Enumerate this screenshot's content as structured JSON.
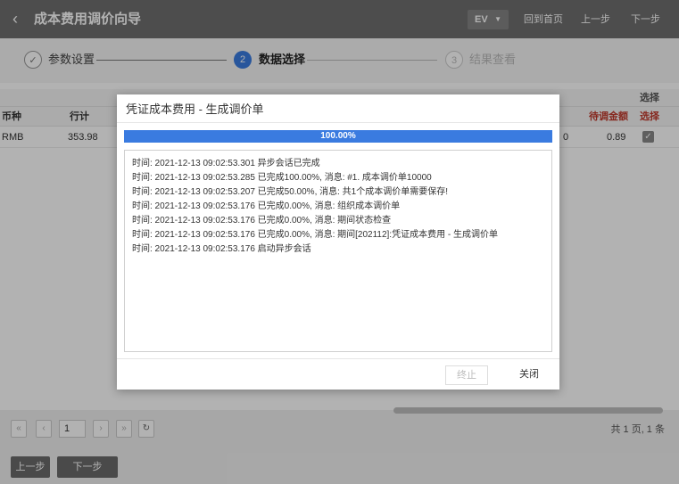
{
  "header": {
    "title": "成本费用调价向导",
    "org_select": "EV",
    "links": [
      "回到首页",
      "上一步",
      "下一步"
    ]
  },
  "steps": [
    {
      "num": "✓",
      "label": "参数设置",
      "state": "done"
    },
    {
      "num": "2",
      "label": "数据选择",
      "state": "active"
    },
    {
      "num": "3",
      "label": "结果查看",
      "state": "pending"
    }
  ],
  "grid": {
    "group_header": "选择",
    "columns": [
      "币种",
      "行计",
      "待调金额",
      "选择"
    ],
    "row": {
      "currency": "RMB",
      "amount": "353.98",
      "hidden_tail": "0",
      "pending": "0.89",
      "selected": true
    }
  },
  "pager": {
    "page": "1",
    "total": "共 1 页, 1 条"
  },
  "footer_buttons": [
    "上一步",
    "下一步"
  ],
  "dialog": {
    "title": "凭证成本费用 - 生成调价单",
    "progress_pct": 100,
    "progress_text": "100.00%",
    "log": [
      "时间: 2021-12-13 09:02:53.301 异步会话已完成",
      "时间: 2021-12-13 09:02:53.285 已完成100.00%, 消息: #1. 成本调价单10000",
      "时间: 2021-12-13 09:02:53.207 已完成50.00%, 消息: 共1个成本调价单需要保存!",
      "时间: 2021-12-13 09:02:53.176 已完成0.00%, 消息: 组织成本调价单",
      "时间: 2021-12-13 09:02:53.176 已完成0.00%, 消息: 期间状态检查",
      "时间: 2021-12-13 09:02:53.176 已完成0.00%, 消息: 期间[202112]:凭证成本费用 - 生成调价单",
      "时间: 2021-12-13 09:02:53.176 启动异步会话"
    ],
    "buttons": {
      "stop": "终止",
      "close": "关闭"
    }
  },
  "colors": {
    "header_bg": "#6f6f6f",
    "accent_blue": "#3a7be0",
    "warning_red": "#c0392b"
  }
}
